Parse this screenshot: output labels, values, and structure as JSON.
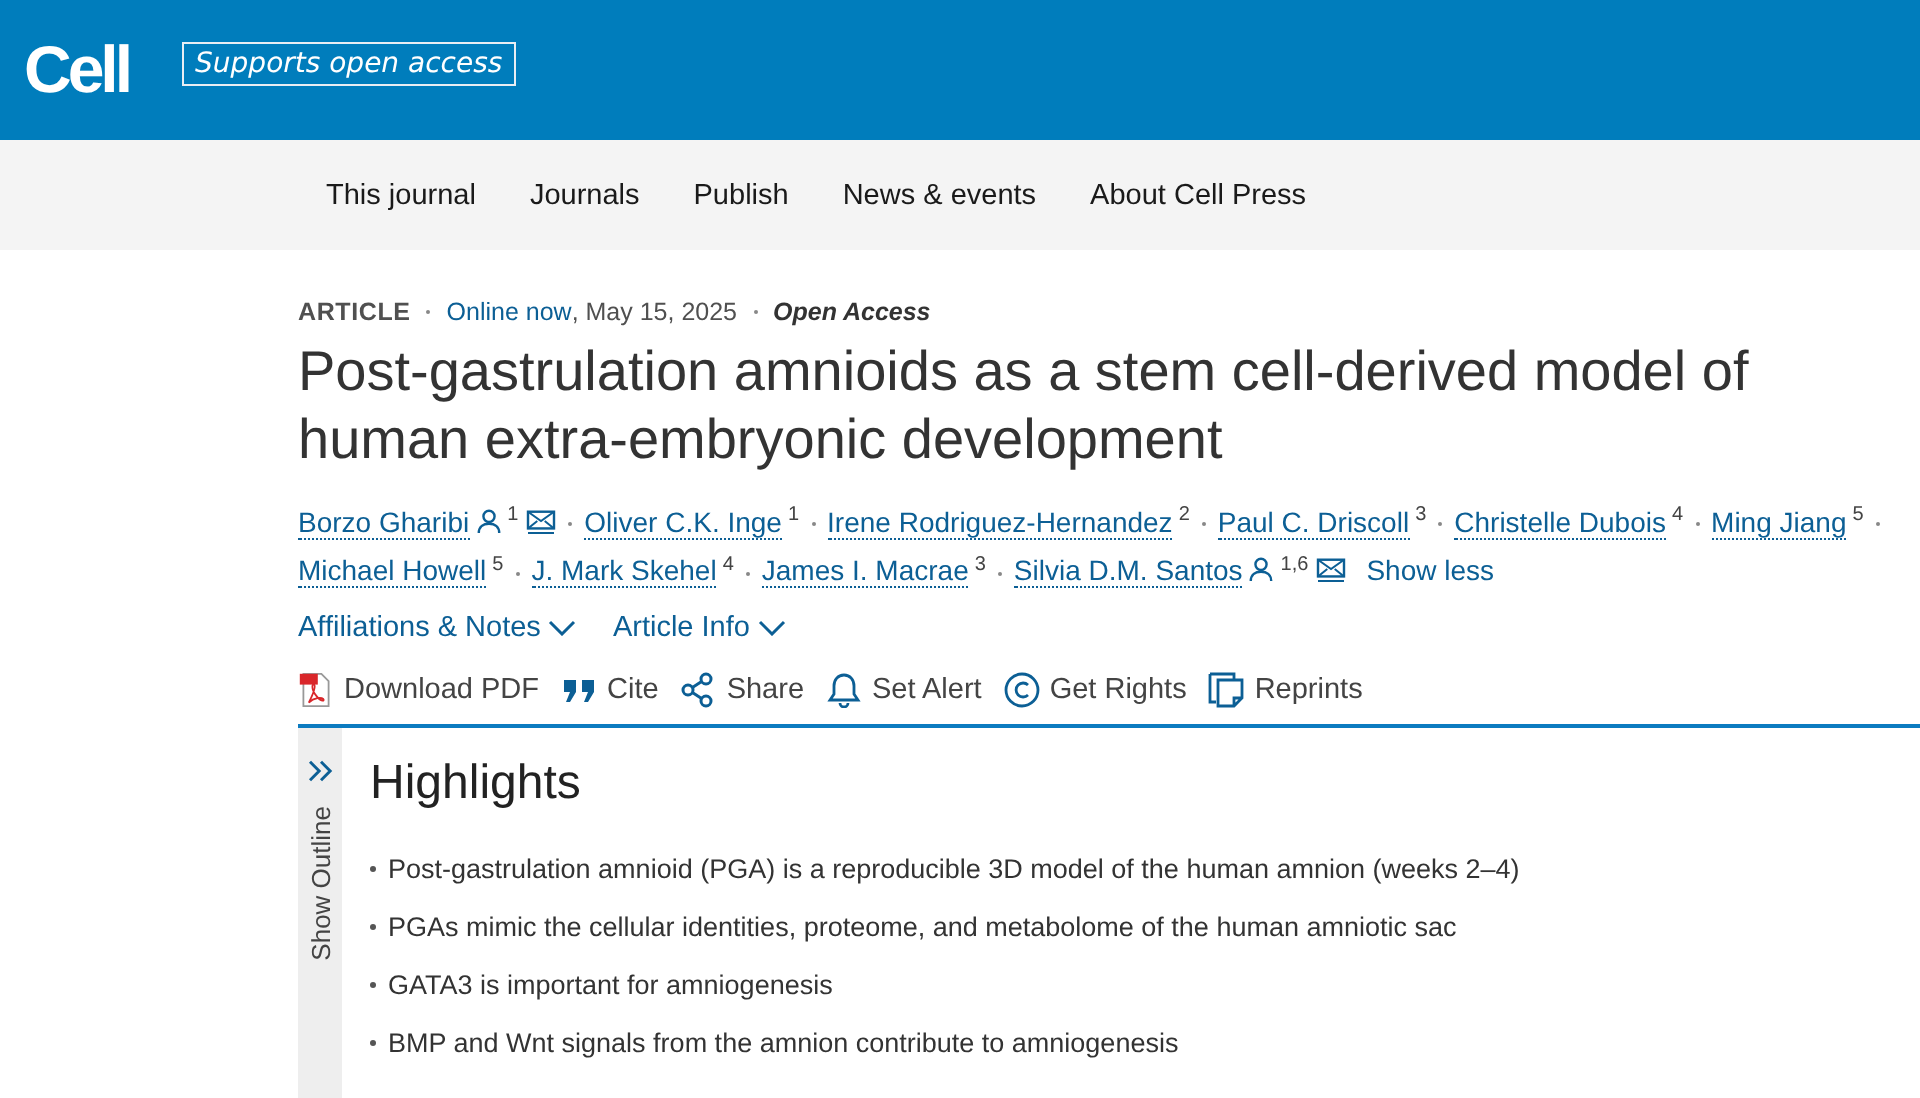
{
  "header": {
    "logo": "Cell",
    "tagline": "Supports open access"
  },
  "nav": [
    "This journal",
    "Journals",
    "Publish",
    "News & events",
    "About Cell Press"
  ],
  "meta": {
    "type": "ARTICLE",
    "status": "Online now",
    "date": ", May 15, 2025",
    "access": "Open Access"
  },
  "title": "Post-gastrulation amnioids as a stem cell-derived model of human extra-embryonic development",
  "authors": [
    {
      "name": "Borzo Gharibi",
      "corresponding": true,
      "affil": "1",
      "email": true
    },
    {
      "name": "Oliver C.K. Inge",
      "corresponding": false,
      "affil": "1",
      "email": false
    },
    {
      "name": "Irene Rodriguez-Hernandez",
      "corresponding": false,
      "affil": "2",
      "email": false
    },
    {
      "name": "Paul C. Driscoll",
      "corresponding": false,
      "affil": "3",
      "email": false
    },
    {
      "name": "Christelle Dubois",
      "corresponding": false,
      "affil": "4",
      "email": false
    },
    {
      "name": "Ming Jiang",
      "corresponding": false,
      "affil": "5",
      "email": false
    },
    {
      "name": "Michael Howell",
      "corresponding": false,
      "affil": "5",
      "email": false
    },
    {
      "name": "J. Mark Skehel",
      "corresponding": false,
      "affil": "4",
      "email": false
    },
    {
      "name": "James I. Macrae",
      "corresponding": false,
      "affil": "3",
      "email": false
    },
    {
      "name": "Silvia D.M. Santos",
      "corresponding": true,
      "affil": "1,6",
      "email": true
    }
  ],
  "show_less": "Show less",
  "dropdowns": [
    "Affiliations & Notes",
    "Article Info"
  ],
  "actions": [
    {
      "kind": "pdf",
      "label": "Download PDF"
    },
    {
      "kind": "cite",
      "label": "Cite"
    },
    {
      "kind": "share",
      "label": "Share"
    },
    {
      "kind": "alert",
      "label": "Set Alert"
    },
    {
      "kind": "rights",
      "label": "Get Rights"
    },
    {
      "kind": "reprints",
      "label": "Reprints"
    }
  ],
  "outline": {
    "label": "Show Outline"
  },
  "highlights": {
    "heading": "Highlights",
    "items": [
      "Post-gastrulation amnioid (PGA) is a reproducible 3D model of the human amnion (weeks 2–4)",
      "PGAs mimic the cellular identities, proteome, and metabolome of the human amniotic sac",
      "GATA3 is important for amniogenesis",
      "BMP and Wnt signals from the amnion contribute to amniogenesis"
    ]
  }
}
